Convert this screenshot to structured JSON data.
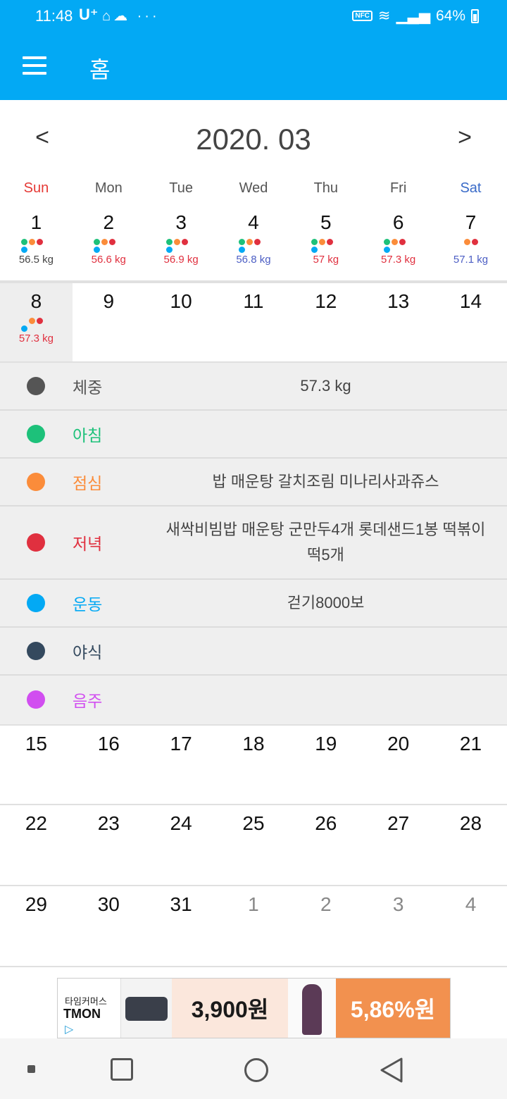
{
  "status_bar": {
    "time": "11:48",
    "carrier": "U⁺",
    "battery": "64%",
    "nfc": "NFC"
  },
  "app_bar": {
    "title": "홈"
  },
  "calendar": {
    "month_title": "2020. 03",
    "prev": "<",
    "next": ">",
    "weekdays": [
      "Sun",
      "Mon",
      "Tue",
      "Wed",
      "Thu",
      "Fri",
      "Sat"
    ],
    "weeks": [
      [
        {
          "day": "1",
          "weight": "56.5 kg"
        },
        {
          "day": "2",
          "weight": "56.6 kg"
        },
        {
          "day": "3",
          "weight": "56.9 kg"
        },
        {
          "day": "4",
          "weight": "56.8 kg"
        },
        {
          "day": "5",
          "weight": "57 kg"
        },
        {
          "day": "6",
          "weight": "57.3 kg"
        },
        {
          "day": "7",
          "weight": "57.1 kg"
        }
      ],
      [
        {
          "day": "8",
          "weight": "57.3 kg"
        },
        {
          "day": "9"
        },
        {
          "day": "10"
        },
        {
          "day": "11"
        },
        {
          "day": "12"
        },
        {
          "day": "13"
        },
        {
          "day": "14"
        }
      ],
      [
        {
          "day": "15"
        },
        {
          "day": "16"
        },
        {
          "day": "17"
        },
        {
          "day": "18"
        },
        {
          "day": "19"
        },
        {
          "day": "20"
        },
        {
          "day": "21"
        }
      ],
      [
        {
          "day": "22"
        },
        {
          "day": "23"
        },
        {
          "day": "24"
        },
        {
          "day": "25"
        },
        {
          "day": "26"
        },
        {
          "day": "27"
        },
        {
          "day": "28"
        }
      ],
      [
        {
          "day": "29"
        },
        {
          "day": "30"
        },
        {
          "day": "31"
        },
        {
          "day": "1"
        },
        {
          "day": "2"
        },
        {
          "day": "3"
        },
        {
          "day": "4"
        }
      ]
    ]
  },
  "detail": {
    "rows": [
      {
        "label": "체중",
        "value": "57.3 kg",
        "color": "#555555"
      },
      {
        "label": "아침",
        "value": "",
        "color": "#1dc17a"
      },
      {
        "label": "점심",
        "value": "밥 매운탕 갈치조림 미나리사과쥬스",
        "color": "#fb8c3a"
      },
      {
        "label": "저녁",
        "value": "새싹비빔밥  매운탕 군만두4개 롯데샌드1봉 떡볶이떡5개",
        "color": "#e0303f"
      },
      {
        "label": "운동",
        "value": "걷기8000보",
        "color": "#03a9f4"
      },
      {
        "label": "야식",
        "value": "",
        "color": "#34495e"
      },
      {
        "label": "음주",
        "value": "",
        "color": "#d14ef0"
      }
    ]
  },
  "ad": {
    "brand_small": "타임커머스",
    "brand": "TMON",
    "price1": "3,900원",
    "price2": "5,86%원"
  }
}
